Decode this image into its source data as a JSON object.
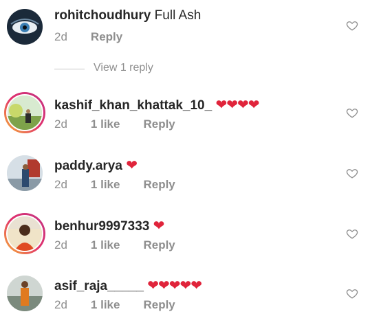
{
  "comments": [
    {
      "username": "rohitchoudhury",
      "text": "Full Ash",
      "hearts": "",
      "age": "2d",
      "likes": "",
      "reply": "Reply"
    },
    {
      "username": "kashif_khan_khattak_10_",
      "text": "",
      "hearts": "❤❤❤❤",
      "age": "2d",
      "likes": "1 like",
      "reply": "Reply"
    },
    {
      "username": "paddy.arya",
      "text": "",
      "hearts": "❤",
      "age": "2d",
      "likes": "1 like",
      "reply": "Reply"
    },
    {
      "username": "benhur9997333",
      "text": "",
      "hearts": "❤",
      "age": "2d",
      "likes": "1 like",
      "reply": "Reply"
    },
    {
      "username": "asif_raja_____",
      "text": "",
      "hearts": "❤❤❤❤❤",
      "age": "2d",
      "likes": "1 like",
      "reply": "Reply"
    }
  ],
  "view_replies": "View 1 reply",
  "icons": {
    "like": "heart-outline-icon"
  },
  "colors": {
    "heart": "#e0243b",
    "meta": "#8e8e8e",
    "text": "#262626"
  }
}
